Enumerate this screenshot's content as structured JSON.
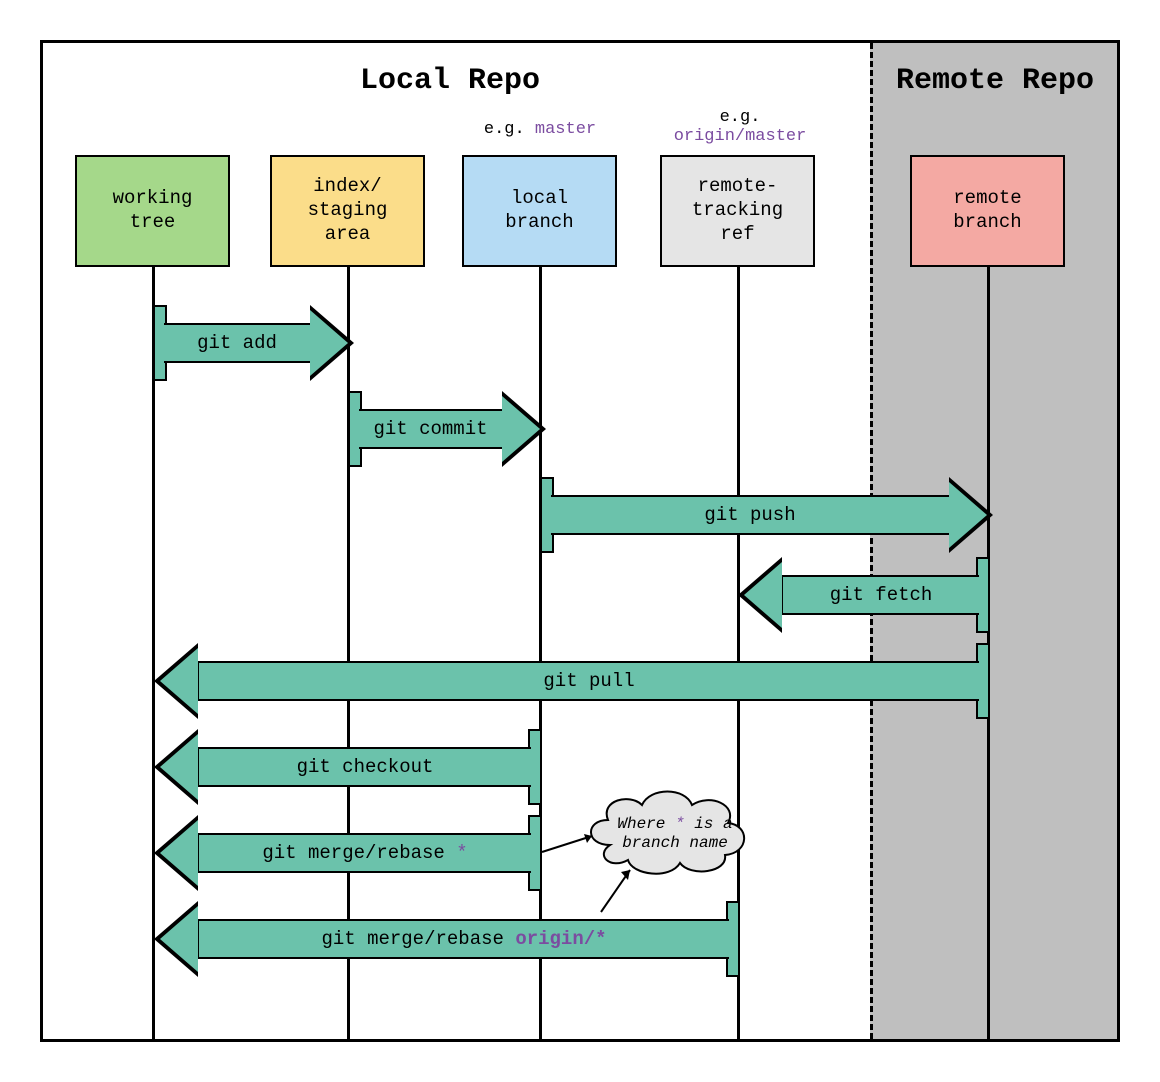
{
  "sections": {
    "local_title": "Local Repo",
    "remote_title": "Remote Repo"
  },
  "eg_labels": {
    "local_branch_prefix": "e.g. ",
    "local_branch_code": "master",
    "remote_ref_prefix": "e.g.",
    "remote_ref_code": "origin/master"
  },
  "lanes": {
    "working_tree": "working\ntree",
    "staging": "index/\nstaging\narea",
    "local_branch": "local\nbranch",
    "remote_ref": "remote-\ntracking\nref",
    "remote_branch": "remote\nbranch"
  },
  "arrows": {
    "add": "git add",
    "commit": "git commit",
    "push": "git push",
    "fetch": "git fetch",
    "pull": "git pull",
    "checkout": "git checkout",
    "merge1_prefix": "git merge/rebase ",
    "merge1_star": "*",
    "merge2_prefix": "git merge/rebase ",
    "merge2_code": "origin/*"
  },
  "cloud": {
    "line1_a": "Where ",
    "line1_star": "*",
    "line1_b": " is a",
    "line2": "branch name"
  },
  "colors": {
    "arrow_fill": "#6bc2ab",
    "working_tree": "#a5d88a",
    "staging": "#fbdd8a",
    "local_branch": "#b5dbf4",
    "remote_ref": "#e5e5e5",
    "remote_branch": "#f4a9a3"
  }
}
